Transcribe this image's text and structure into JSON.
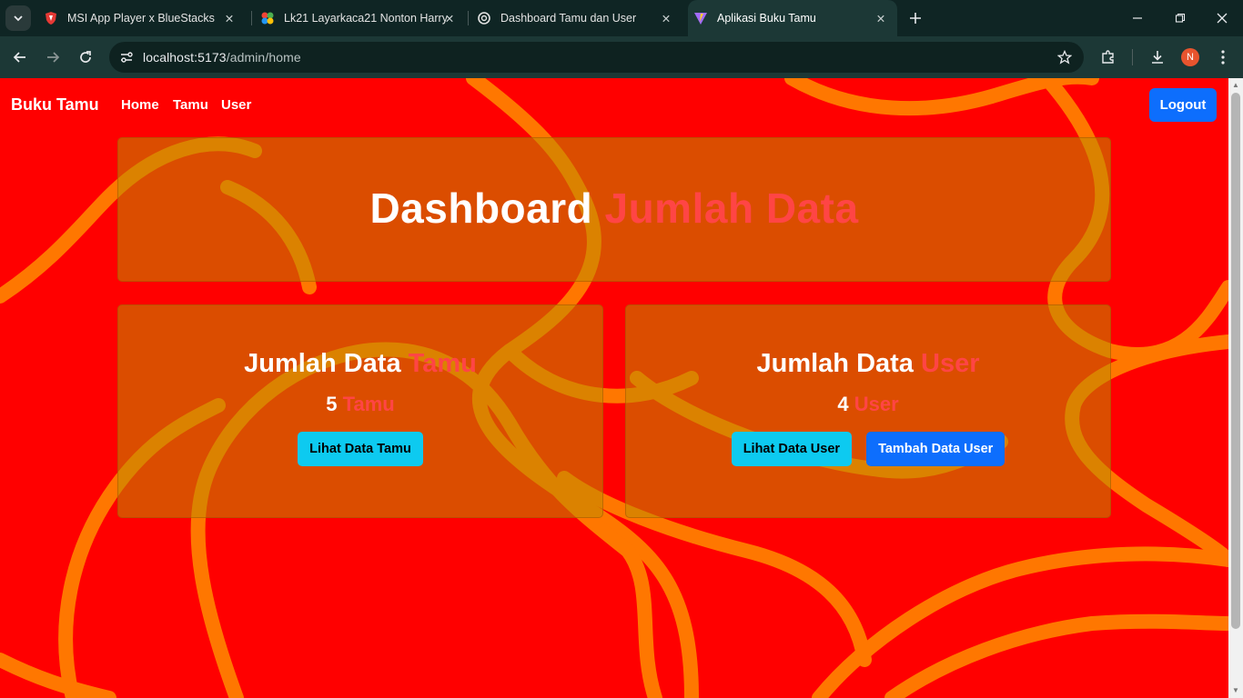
{
  "browser": {
    "tabs": [
      {
        "title": "MSI App Player x BlueStacks",
        "icon": "msi-icon"
      },
      {
        "title": "Lk21 Layarkaca21 Nonton Harry",
        "icon": "lk21-icon"
      },
      {
        "title": "Dashboard Tamu dan User",
        "icon": "openai-icon"
      },
      {
        "title": "Aplikasi Buku Tamu",
        "icon": "vite-icon",
        "active": true
      }
    ],
    "url_host": "localhost:5173",
    "url_path": "/admin/home",
    "profile_initial": "N"
  },
  "navbar": {
    "brand": "Buku Tamu",
    "links": [
      "Home",
      "Tamu",
      "User"
    ],
    "logout_label": "Logout"
  },
  "hero": {
    "title_main": "Dashboard",
    "title_accent": "Jumlah Data"
  },
  "cards": [
    {
      "title_main": "Jumlah Data",
      "title_accent": "Tamu",
      "count": "5",
      "count_unit": "Tamu",
      "buttons": [
        "Lihat Data Tamu"
      ]
    },
    {
      "title_main": "Jumlah Data",
      "title_accent": "User",
      "count": "4",
      "count_unit": "User",
      "buttons": [
        "Lihat Data User",
        "Tambah Data User"
      ]
    }
  ],
  "colors": {
    "page_bg": "#ff0000",
    "accent_text": "#ff4545",
    "primary": "#0d6efd",
    "info": "#0dcaf0"
  }
}
